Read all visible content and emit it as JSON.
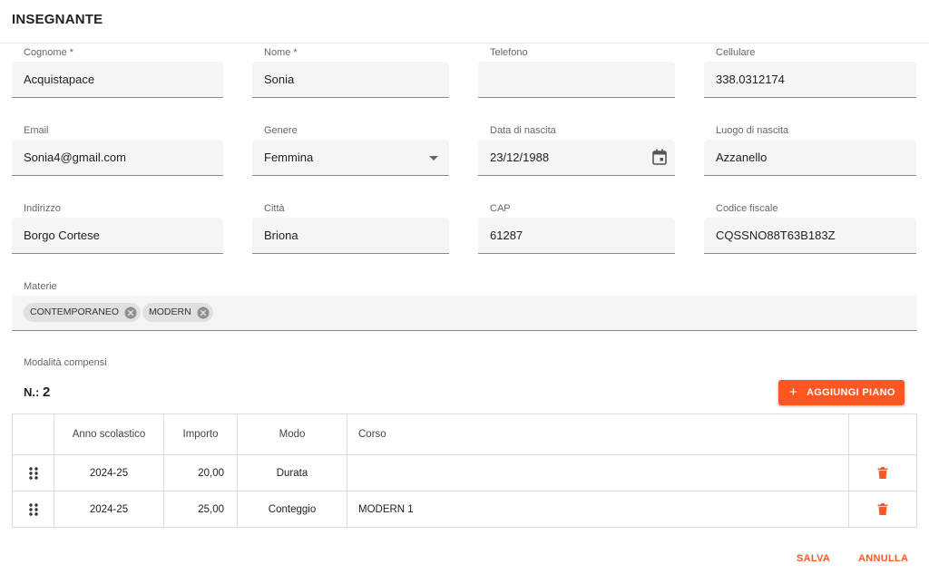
{
  "header": {
    "title": "INSEGNANTE"
  },
  "fields": {
    "cognome": {
      "label": "Cognome *",
      "value": "Acquistapace"
    },
    "nome": {
      "label": "Nome *",
      "value": "Sonia"
    },
    "telefono": {
      "label": "Telefono",
      "value": ""
    },
    "cellulare": {
      "label": "Cellulare",
      "value": "338.0312174"
    },
    "email": {
      "label": "Email",
      "value": "Sonia4@gmail.com"
    },
    "genere": {
      "label": "Genere",
      "value": "Femmina"
    },
    "data_nascita": {
      "label": "Data di nascita",
      "value": "23/12/1988"
    },
    "luogo_nascita": {
      "label": "Luogo di nascita",
      "value": "Azzanello"
    },
    "indirizzo": {
      "label": "Indirizzo",
      "value": "Borgo Cortese"
    },
    "citta": {
      "label": "Città",
      "value": "Briona"
    },
    "cap": {
      "label": "CAP",
      "value": "61287"
    },
    "codice_fiscale": {
      "label": "Codice fiscale",
      "value": "CQSSNO88T63B183Z"
    }
  },
  "materie": {
    "label": "Materie",
    "chips": [
      "CONTEMPORANEO",
      "MODERN"
    ]
  },
  "compensi": {
    "label": "Modalità compensi",
    "count_prefix": "N.:",
    "count": "2",
    "add_button": "AGGIUNGI PIANO",
    "columns": [
      "Anno scolastico",
      "Importo",
      "Modo",
      "Corso"
    ],
    "rows": [
      {
        "anno": "2024-25",
        "importo": "20,00",
        "modo": "Durata",
        "corso": ""
      },
      {
        "anno": "2024-25",
        "importo": "25,00",
        "modo": "Conteggio",
        "corso": "MODERN 1"
      }
    ]
  },
  "footer": {
    "save": "SALVA",
    "cancel": "ANNULLA"
  },
  "colors": {
    "accent": "#ff5722",
    "field_bg": "#f5f5f5",
    "chip_bg": "#e0e0e0"
  },
  "icons": {
    "select": "chevron-down-icon",
    "date": "calendar-icon",
    "chip_remove": "close-circle-icon",
    "drag": "drag-handle-icon",
    "delete": "trash-icon",
    "add": "plus-icon"
  }
}
